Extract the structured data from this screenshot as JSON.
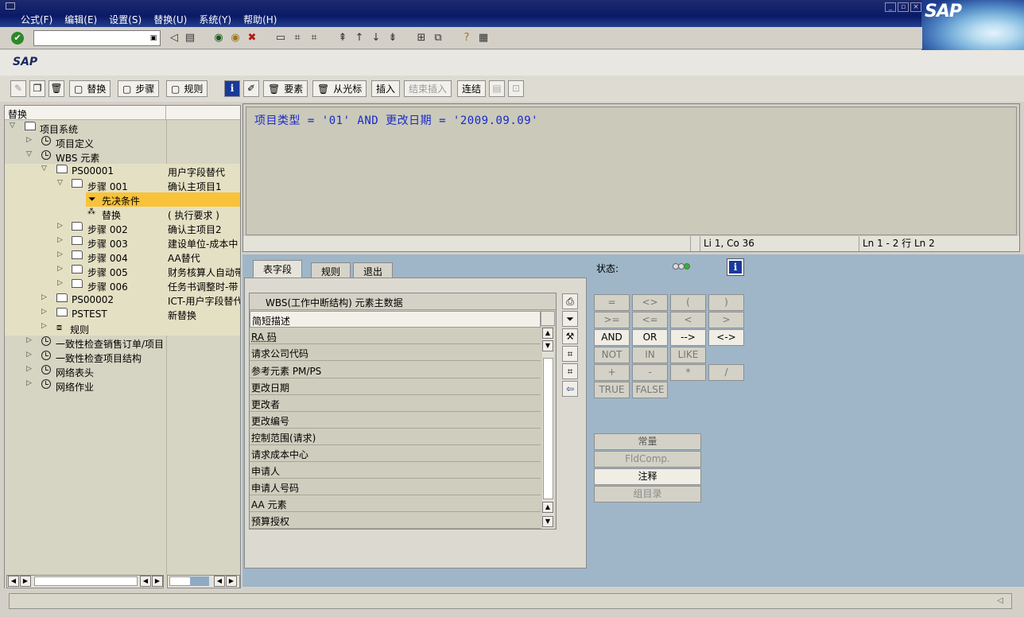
{
  "menubar": {
    "items": [
      "公式(F)",
      "编辑(E)",
      "设置(S)",
      "替换(U)",
      "系统(Y)",
      "帮助(H)"
    ],
    "logo": "SAP"
  },
  "title": "SAP",
  "app_toolbar": {
    "replace": "替换",
    "step": "步骤",
    "rule": "规则",
    "element": "要素",
    "from_cursor": "从光标",
    "insert": "插入",
    "end_insert": "结束插入",
    "concat": "连结"
  },
  "tree": {
    "header": "替换",
    "rows": [
      {
        "label": "项目系统",
        "col2": ""
      },
      {
        "label": "项目定义",
        "col2": ""
      },
      {
        "label": "WBS 元素",
        "col2": ""
      },
      {
        "label": "PS00001",
        "col2": "用户字段替代"
      },
      {
        "label": "步骤 001",
        "col2": "确认主项目1"
      },
      {
        "label": "先决条件",
        "col2": ""
      },
      {
        "label": "替换",
        "col2": "( 执行要求 )"
      },
      {
        "label": "步骤 002",
        "col2": "确认主项目2"
      },
      {
        "label": "步骤 003",
        "col2": "建设单位-成本中"
      },
      {
        "label": "步骤 004",
        "col2": "AA替代"
      },
      {
        "label": "步骤 005",
        "col2": "财务核算人自动带"
      },
      {
        "label": "步骤 006",
        "col2": "任务书调整时-带"
      },
      {
        "label": "PS00002",
        "col2": "ICT-用户字段替代"
      },
      {
        "label": "PSTEST",
        "col2": "新替换"
      },
      {
        "label": "规则",
        "col2": ""
      },
      {
        "label": "一致性检查销售订单/项目",
        "col2": ""
      },
      {
        "label": "一致性检查项目结构",
        "col2": ""
      },
      {
        "label": "网络表头",
        "col2": ""
      },
      {
        "label": "网络作业",
        "col2": ""
      }
    ]
  },
  "editor": {
    "code": "项目类型 = '01' AND 更改日期 = '2009.09.09'",
    "position": "Li 1, Co 36",
    "lines": "Ln 1 - 2 行 Ln 2"
  },
  "tabs": [
    "表字段",
    "规则",
    "退出"
  ],
  "fieldlist": {
    "header": "WBS(工作中断结构) 元素主数据",
    "items": [
      "简短描述",
      "RA 码",
      "请求公司代码",
      "参考元素 PM/PS",
      "更改日期",
      "更改者",
      "更改编号",
      "控制范围(请求)",
      "请求成本中心",
      "申请人",
      "申请人号码",
      "AA 元素",
      "预算授权"
    ]
  },
  "status_label": "状态:",
  "info_icon": "i",
  "operators": [
    [
      "=",
      "<>",
      "(",
      ")"
    ],
    [
      ">=",
      "<=",
      "<",
      ">"
    ],
    [
      "AND",
      "OR",
      "-->",
      "<->"
    ],
    [
      "NOT",
      "IN",
      "LIKE"
    ],
    [
      "+",
      "-",
      "*",
      "/"
    ],
    [
      "TRUE",
      "FALSE"
    ]
  ],
  "wide_buttons": [
    "常量",
    "FldComp.",
    "注释",
    "组目录"
  ],
  "colors": {
    "menubar": "#0a1a66",
    "code": "#1a2ac8",
    "selection": "#f8c23a",
    "workarea": "#9fb6c8"
  }
}
